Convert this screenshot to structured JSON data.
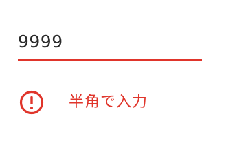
{
  "field": {
    "value": "9999",
    "error_message": "半角で入力",
    "error_icon": "exclamation-circle-icon"
  },
  "colors": {
    "error": "#e0352b",
    "text": "#2b2b2b",
    "background": "#ffffff"
  }
}
